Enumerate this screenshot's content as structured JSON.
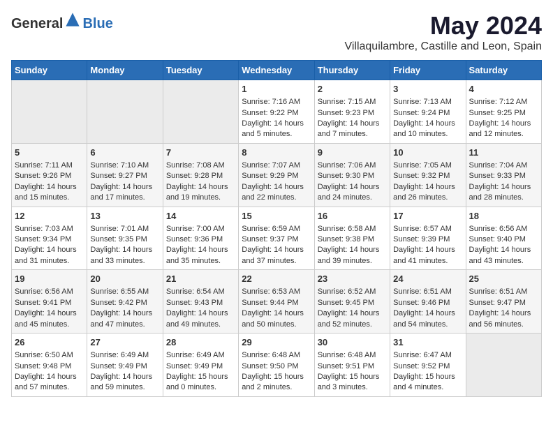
{
  "header": {
    "logo_general": "General",
    "logo_blue": "Blue",
    "month": "May 2024",
    "location": "Villaquilambre, Castille and Leon, Spain"
  },
  "days_of_week": [
    "Sunday",
    "Monday",
    "Tuesday",
    "Wednesday",
    "Thursday",
    "Friday",
    "Saturday"
  ],
  "weeks": [
    [
      {
        "day": "",
        "sunrise": "",
        "sunset": "",
        "daylight": ""
      },
      {
        "day": "",
        "sunrise": "",
        "sunset": "",
        "daylight": ""
      },
      {
        "day": "",
        "sunrise": "",
        "sunset": "",
        "daylight": ""
      },
      {
        "day": "1",
        "sunrise": "Sunrise: 7:16 AM",
        "sunset": "Sunset: 9:22 PM",
        "daylight": "Daylight: 14 hours and 5 minutes."
      },
      {
        "day": "2",
        "sunrise": "Sunrise: 7:15 AM",
        "sunset": "Sunset: 9:23 PM",
        "daylight": "Daylight: 14 hours and 7 minutes."
      },
      {
        "day": "3",
        "sunrise": "Sunrise: 7:13 AM",
        "sunset": "Sunset: 9:24 PM",
        "daylight": "Daylight: 14 hours and 10 minutes."
      },
      {
        "day": "4",
        "sunrise": "Sunrise: 7:12 AM",
        "sunset": "Sunset: 9:25 PM",
        "daylight": "Daylight: 14 hours and 12 minutes."
      }
    ],
    [
      {
        "day": "5",
        "sunrise": "Sunrise: 7:11 AM",
        "sunset": "Sunset: 9:26 PM",
        "daylight": "Daylight: 14 hours and 15 minutes."
      },
      {
        "day": "6",
        "sunrise": "Sunrise: 7:10 AM",
        "sunset": "Sunset: 9:27 PM",
        "daylight": "Daylight: 14 hours and 17 minutes."
      },
      {
        "day": "7",
        "sunrise": "Sunrise: 7:08 AM",
        "sunset": "Sunset: 9:28 PM",
        "daylight": "Daylight: 14 hours and 19 minutes."
      },
      {
        "day": "8",
        "sunrise": "Sunrise: 7:07 AM",
        "sunset": "Sunset: 9:29 PM",
        "daylight": "Daylight: 14 hours and 22 minutes."
      },
      {
        "day": "9",
        "sunrise": "Sunrise: 7:06 AM",
        "sunset": "Sunset: 9:30 PM",
        "daylight": "Daylight: 14 hours and 24 minutes."
      },
      {
        "day": "10",
        "sunrise": "Sunrise: 7:05 AM",
        "sunset": "Sunset: 9:32 PM",
        "daylight": "Daylight: 14 hours and 26 minutes."
      },
      {
        "day": "11",
        "sunrise": "Sunrise: 7:04 AM",
        "sunset": "Sunset: 9:33 PM",
        "daylight": "Daylight: 14 hours and 28 minutes."
      }
    ],
    [
      {
        "day": "12",
        "sunrise": "Sunrise: 7:03 AM",
        "sunset": "Sunset: 9:34 PM",
        "daylight": "Daylight: 14 hours and 31 minutes."
      },
      {
        "day": "13",
        "sunrise": "Sunrise: 7:01 AM",
        "sunset": "Sunset: 9:35 PM",
        "daylight": "Daylight: 14 hours and 33 minutes."
      },
      {
        "day": "14",
        "sunrise": "Sunrise: 7:00 AM",
        "sunset": "Sunset: 9:36 PM",
        "daylight": "Daylight: 14 hours and 35 minutes."
      },
      {
        "day": "15",
        "sunrise": "Sunrise: 6:59 AM",
        "sunset": "Sunset: 9:37 PM",
        "daylight": "Daylight: 14 hours and 37 minutes."
      },
      {
        "day": "16",
        "sunrise": "Sunrise: 6:58 AM",
        "sunset": "Sunset: 9:38 PM",
        "daylight": "Daylight: 14 hours and 39 minutes."
      },
      {
        "day": "17",
        "sunrise": "Sunrise: 6:57 AM",
        "sunset": "Sunset: 9:39 PM",
        "daylight": "Daylight: 14 hours and 41 minutes."
      },
      {
        "day": "18",
        "sunrise": "Sunrise: 6:56 AM",
        "sunset": "Sunset: 9:40 PM",
        "daylight": "Daylight: 14 hours and 43 minutes."
      }
    ],
    [
      {
        "day": "19",
        "sunrise": "Sunrise: 6:56 AM",
        "sunset": "Sunset: 9:41 PM",
        "daylight": "Daylight: 14 hours and 45 minutes."
      },
      {
        "day": "20",
        "sunrise": "Sunrise: 6:55 AM",
        "sunset": "Sunset: 9:42 PM",
        "daylight": "Daylight: 14 hours and 47 minutes."
      },
      {
        "day": "21",
        "sunrise": "Sunrise: 6:54 AM",
        "sunset": "Sunset: 9:43 PM",
        "daylight": "Daylight: 14 hours and 49 minutes."
      },
      {
        "day": "22",
        "sunrise": "Sunrise: 6:53 AM",
        "sunset": "Sunset: 9:44 PM",
        "daylight": "Daylight: 14 hours and 50 minutes."
      },
      {
        "day": "23",
        "sunrise": "Sunrise: 6:52 AM",
        "sunset": "Sunset: 9:45 PM",
        "daylight": "Daylight: 14 hours and 52 minutes."
      },
      {
        "day": "24",
        "sunrise": "Sunrise: 6:51 AM",
        "sunset": "Sunset: 9:46 PM",
        "daylight": "Daylight: 14 hours and 54 minutes."
      },
      {
        "day": "25",
        "sunrise": "Sunrise: 6:51 AM",
        "sunset": "Sunset: 9:47 PM",
        "daylight": "Daylight: 14 hours and 56 minutes."
      }
    ],
    [
      {
        "day": "26",
        "sunrise": "Sunrise: 6:50 AM",
        "sunset": "Sunset: 9:48 PM",
        "daylight": "Daylight: 14 hours and 57 minutes."
      },
      {
        "day": "27",
        "sunrise": "Sunrise: 6:49 AM",
        "sunset": "Sunset: 9:49 PM",
        "daylight": "Daylight: 14 hours and 59 minutes."
      },
      {
        "day": "28",
        "sunrise": "Sunrise: 6:49 AM",
        "sunset": "Sunset: 9:49 PM",
        "daylight": "Daylight: 15 hours and 0 minutes."
      },
      {
        "day": "29",
        "sunrise": "Sunrise: 6:48 AM",
        "sunset": "Sunset: 9:50 PM",
        "daylight": "Daylight: 15 hours and 2 minutes."
      },
      {
        "day": "30",
        "sunrise": "Sunrise: 6:48 AM",
        "sunset": "Sunset: 9:51 PM",
        "daylight": "Daylight: 15 hours and 3 minutes."
      },
      {
        "day": "31",
        "sunrise": "Sunrise: 6:47 AM",
        "sunset": "Sunset: 9:52 PM",
        "daylight": "Daylight: 15 hours and 4 minutes."
      },
      {
        "day": "",
        "sunrise": "",
        "sunset": "",
        "daylight": ""
      }
    ]
  ]
}
